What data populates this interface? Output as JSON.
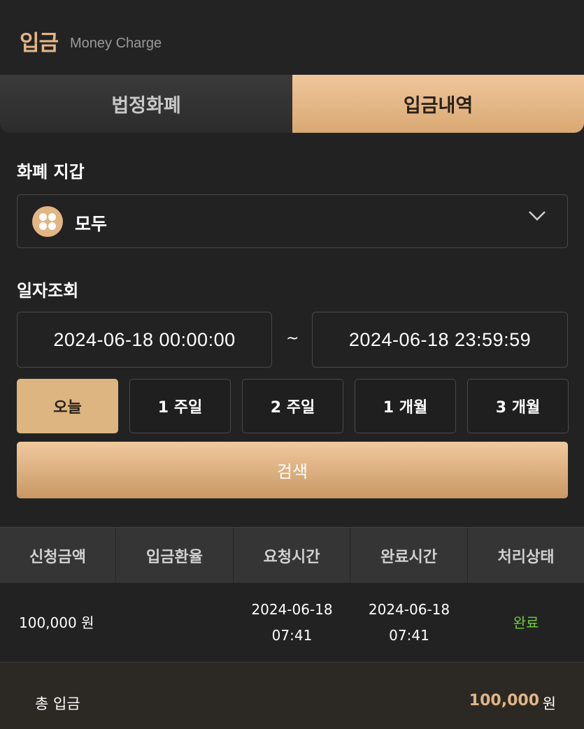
{
  "header": {
    "title": "입금",
    "subtitle": "Money Charge"
  },
  "tabs": [
    {
      "label": "법정화폐",
      "active": false
    },
    {
      "label": "입금내역",
      "active": true
    }
  ],
  "wallet": {
    "label": "화폐 지갑",
    "icon": "coin-grid-icon",
    "selected": "모두"
  },
  "date_query": {
    "label": "일자조회",
    "start": "2024-06-18 00:00:00",
    "separator": "~",
    "end": "2024-06-18 23:59:59"
  },
  "ranges": [
    {
      "label": "오늘",
      "active": true
    },
    {
      "label": "1 주일",
      "active": false
    },
    {
      "label": "2 주일",
      "active": false
    },
    {
      "label": "1 개월",
      "active": false
    },
    {
      "label": "3 개월",
      "active": false
    }
  ],
  "search_label": "검색",
  "table": {
    "headers": [
      "신청금액",
      "입금환율",
      "요청시간",
      "완료시간",
      "처리상태"
    ],
    "rows": [
      {
        "amount": "100,000 원",
        "rate": "",
        "request_date": "2024-06-18",
        "request_time": "07:41",
        "complete_date": "2024-06-18",
        "complete_time": "07:41",
        "status": "완료"
      }
    ]
  },
  "summary": {
    "label": "총 입금",
    "amount": "100,000",
    "unit": "원"
  },
  "colors": {
    "accent": "#e2b585",
    "status_done": "#6fcf3a",
    "background": "#222222"
  }
}
